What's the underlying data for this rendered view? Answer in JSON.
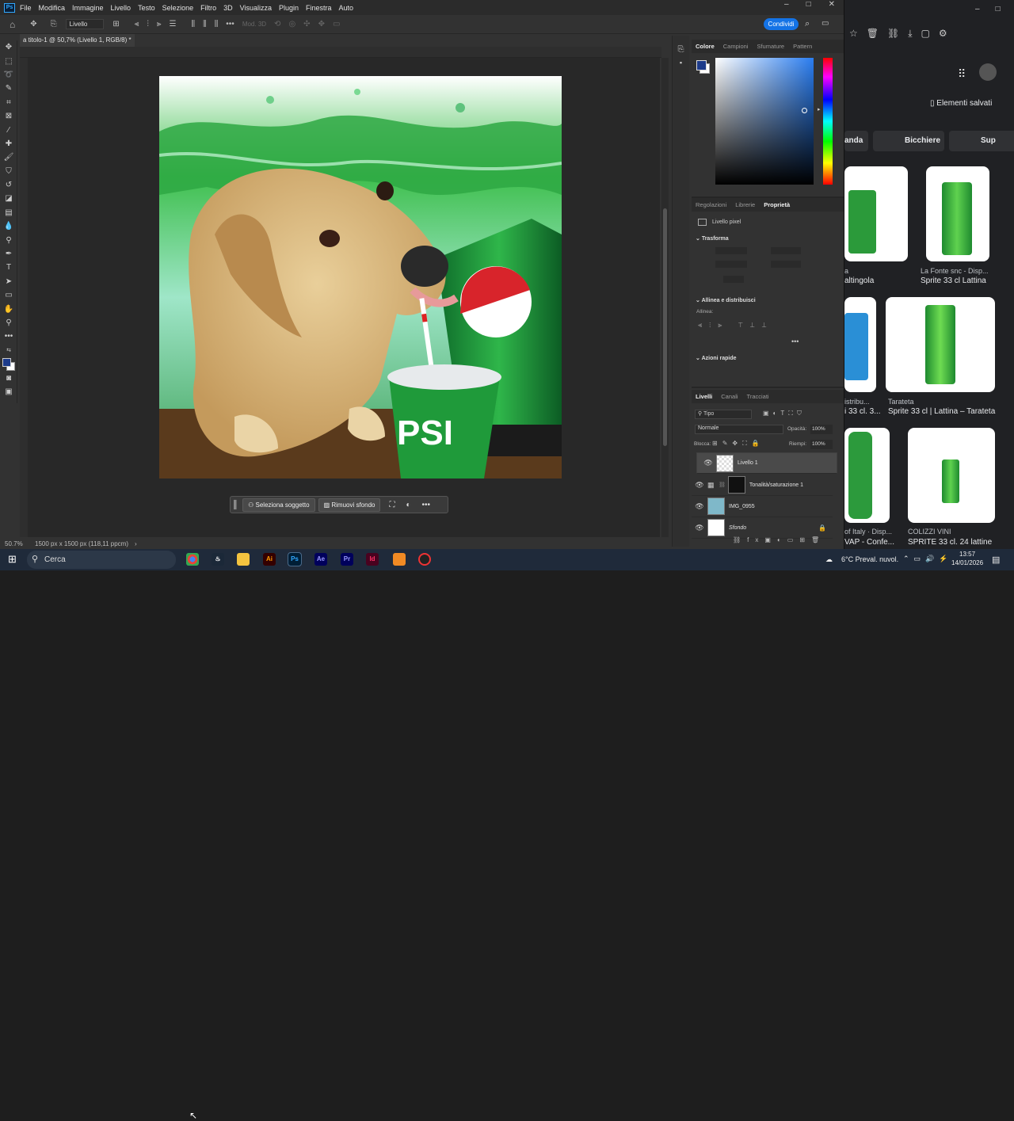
{
  "menu": {
    "app_icon": "Ps",
    "items": [
      "File",
      "Modifica",
      "Immagine",
      "Livello",
      "Testo",
      "Selezione",
      "Filtro",
      "3D",
      "Visualizza",
      "Plugin",
      "Finestra",
      "Auto"
    ]
  },
  "options_bar": {
    "layer_select": "Livello",
    "mode_3d": "Mod. 3D",
    "share_label": "Condividi"
  },
  "document": {
    "tab_title": "a titolo-1 @ 50,7% (Livello 1, RGB/8) *",
    "zoom": "50.7%",
    "dimensions": "1500 px x 1500 px (118,11 ppcm)"
  },
  "context_bar": {
    "select_subject": "Seleziona soggetto",
    "remove_bg": "Rimuovi sfondo"
  },
  "color_panel": {
    "tabs": [
      "Colore",
      "Campioni",
      "Sfumature",
      "Pattern"
    ],
    "fg_color": "#1d3b8a",
    "bg_color": "#ffffff"
  },
  "properties_panel": {
    "tabs": [
      "Regolazioni",
      "Librerie",
      "Proprietà"
    ],
    "layer_type": "Livello pixel",
    "transform_title": "Trasforma",
    "align_title": "Allinea e distribuisci",
    "align_label": "Allinea:",
    "quick_actions": "Azioni rapide"
  },
  "layers_panel": {
    "tabs": [
      "Livelli",
      "Canali",
      "Tracciati"
    ],
    "filter": "Tipo",
    "blend_mode": "Normale",
    "opacity_label": "Opacità:",
    "opacity_value": "100%",
    "lock_label": "Blocca:",
    "fill_label": "Riempi:",
    "fill_value": "100%",
    "layers": [
      {
        "name": "Livello 1",
        "selected": true
      },
      {
        "name": "Tonalità/saturazione 1",
        "selected": false
      },
      {
        "name": "IMG_0955",
        "selected": false
      },
      {
        "name": "Sfondo",
        "selected": false
      }
    ]
  },
  "browser": {
    "saved_label": "Elementi salvati",
    "chips": [
      "anda",
      "Bicchiere",
      "Sup"
    ],
    "results": [
      {
        "source": "a",
        "title": "altingola"
      },
      {
        "source": "La Fonte snc - Disp...",
        "title": "Sprite 33 cl Lattina"
      },
      {
        "source": "istribu...",
        "title": "i 33 cl. 3..."
      },
      {
        "source": "Tarateta",
        "title": "Sprite 33 cl | Lattina – Tarateta"
      },
      {
        "source": "of Italy · Disp...",
        "title": "VAP - Confe..."
      },
      {
        "source": "COLIZZI VINI",
        "title": "SPRITE 33 cl. 24 lattine"
      }
    ]
  },
  "taskbar": {
    "search_placeholder": "Cerca",
    "apps": [
      "Ai",
      "Ps",
      "Ae",
      "Pr",
      "Id"
    ],
    "weather": "6°C  Preval. nuvol.",
    "time": "13:57",
    "date": "14/01/2026"
  }
}
